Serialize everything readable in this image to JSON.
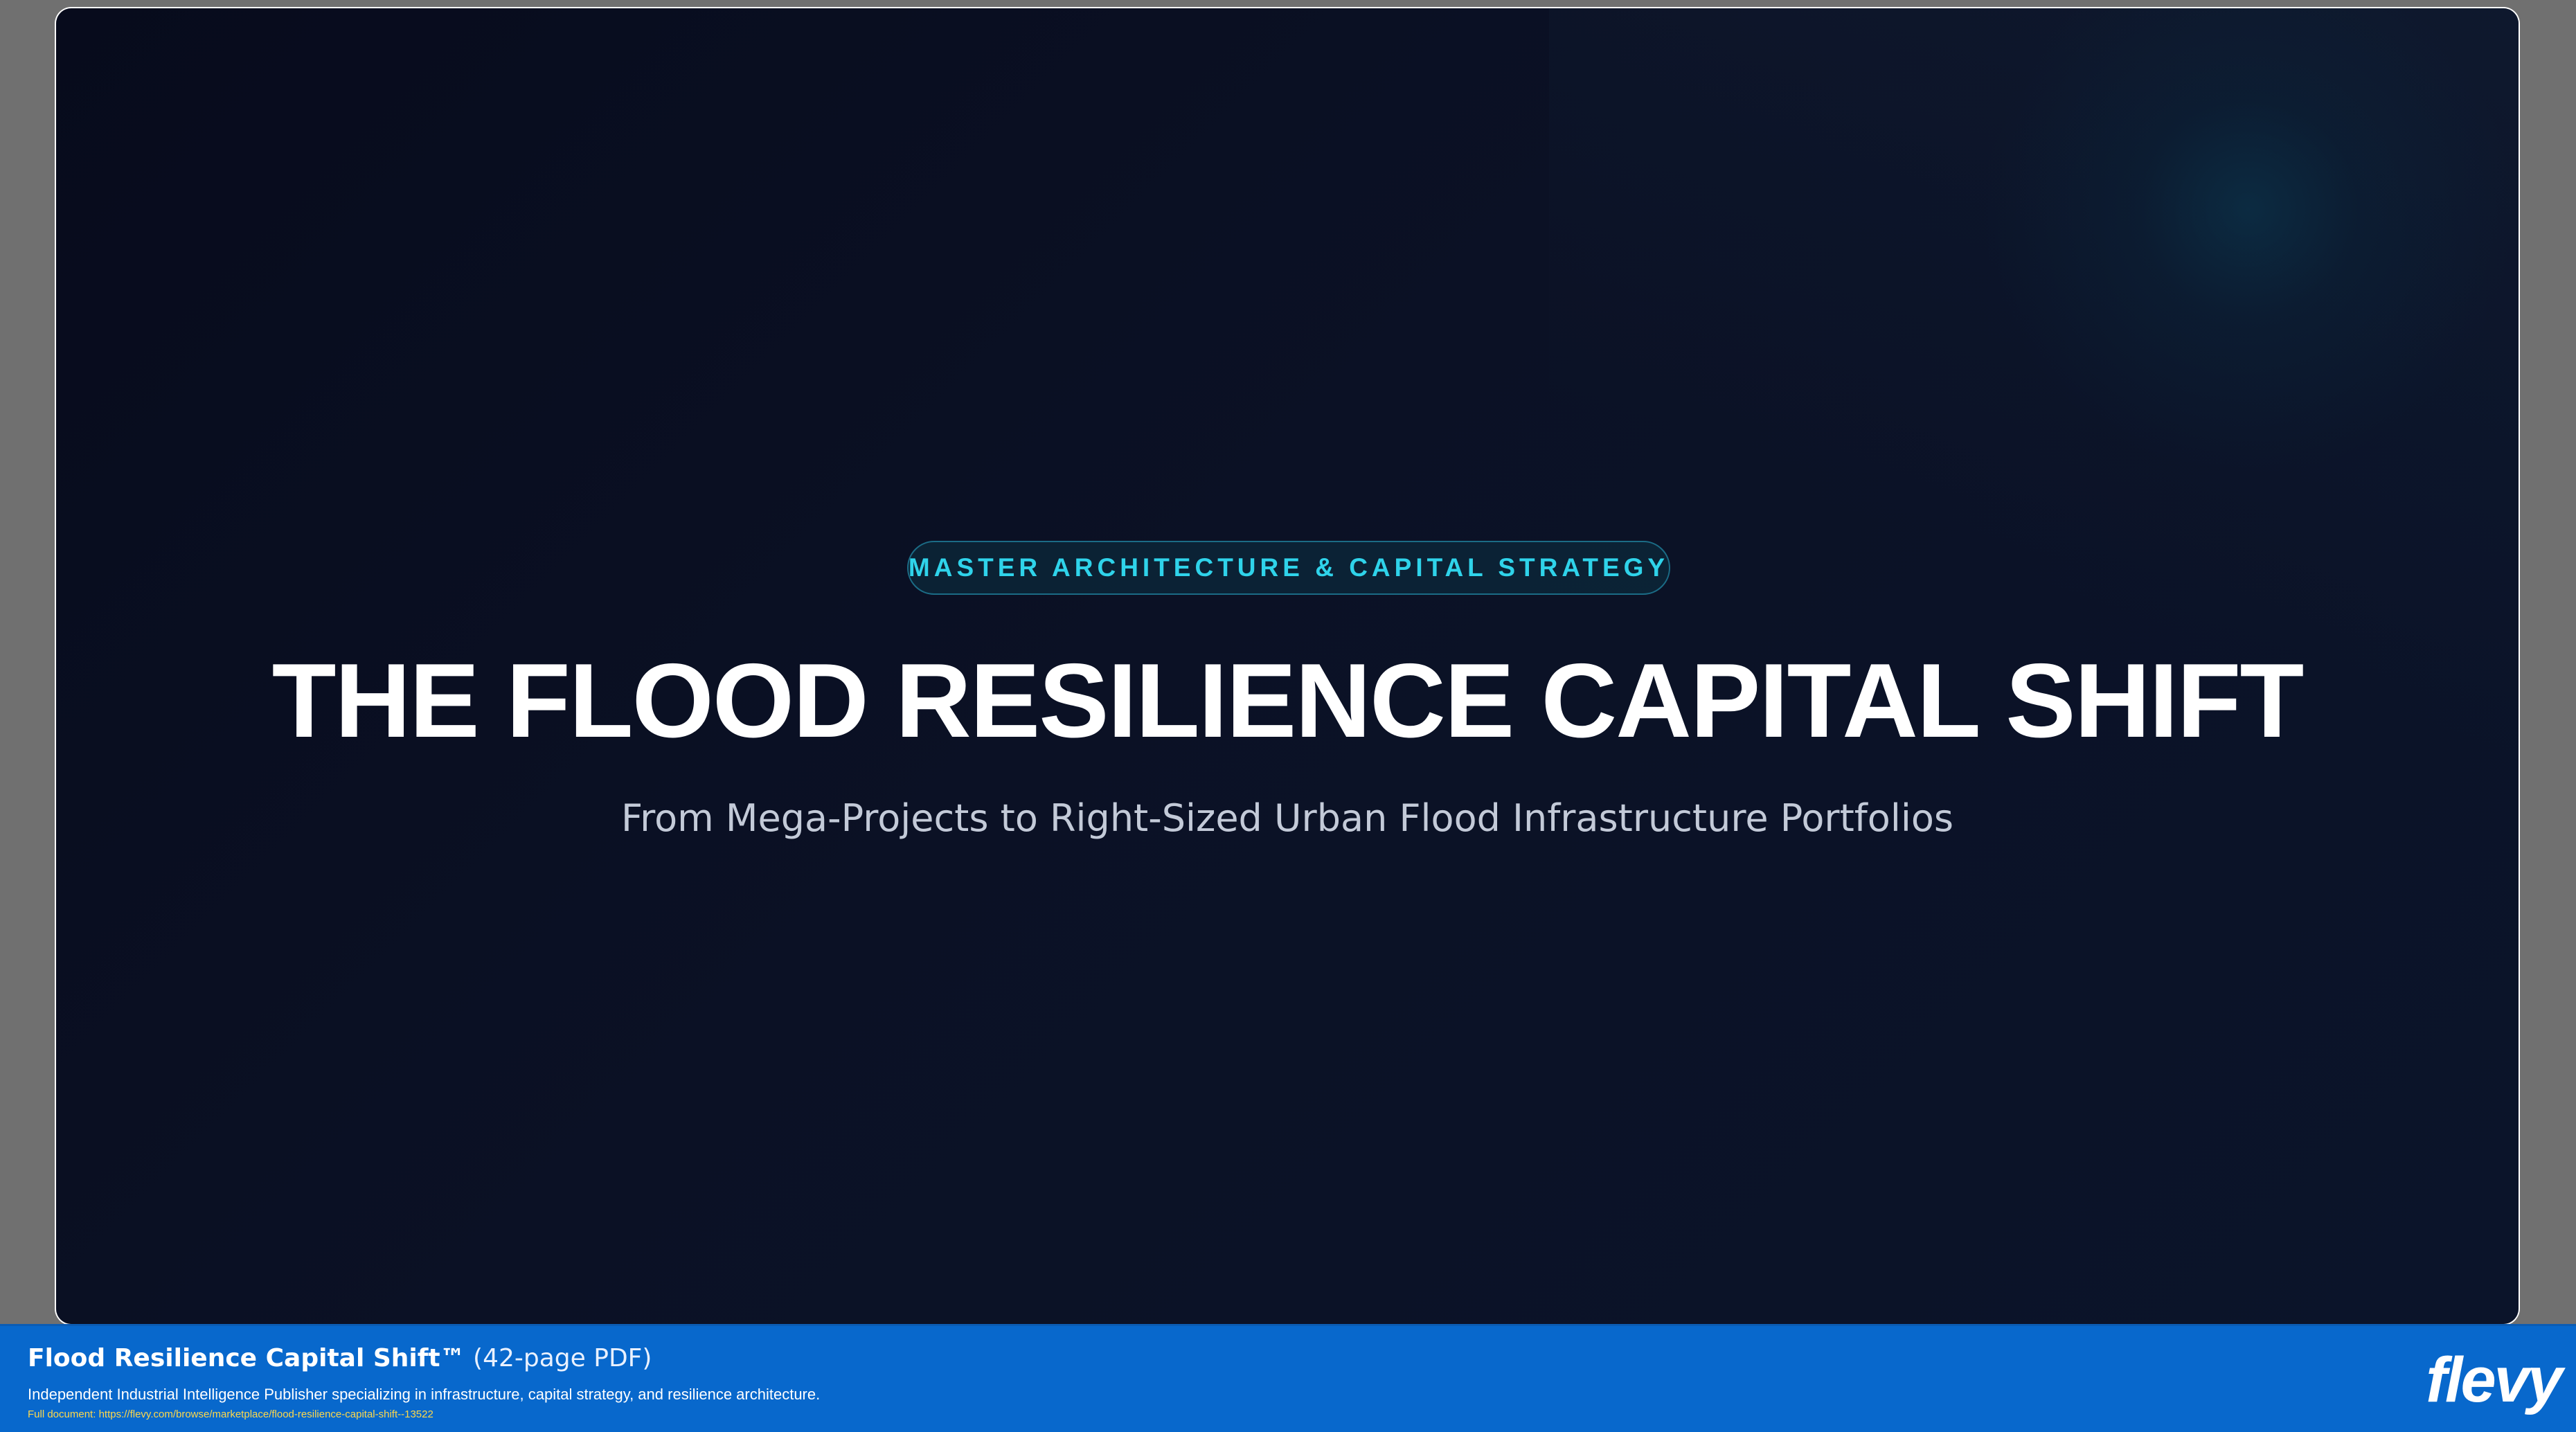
{
  "slide": {
    "eyebrow": "MASTER ARCHITECTURE & CAPITAL STRATEGY",
    "title": "THE FLOOD RESILIENCE CAPITAL SHIFT",
    "subtitle": "From Mega-Projects to Right-Sized Urban Flood Infrastructure Portfolios"
  },
  "footer": {
    "doc_title": "Flood Resilience Capital Shift™",
    "doc_pages": "(42-page PDF)",
    "description": "Independent Industrial Intelligence Publisher specializing in infrastructure, capital strategy, and resilience architecture.",
    "link_label": "Full document:",
    "link_url": "https://flevy.com/browse/marketplace/flood-resilience-capital-shift--13522",
    "logo_text": "flevy"
  },
  "colors": {
    "slide_background": "#0b1125",
    "eyebrow_accent": "#2fd3ea",
    "footer_background": "#0868cc",
    "link_color": "#ffd84a"
  }
}
